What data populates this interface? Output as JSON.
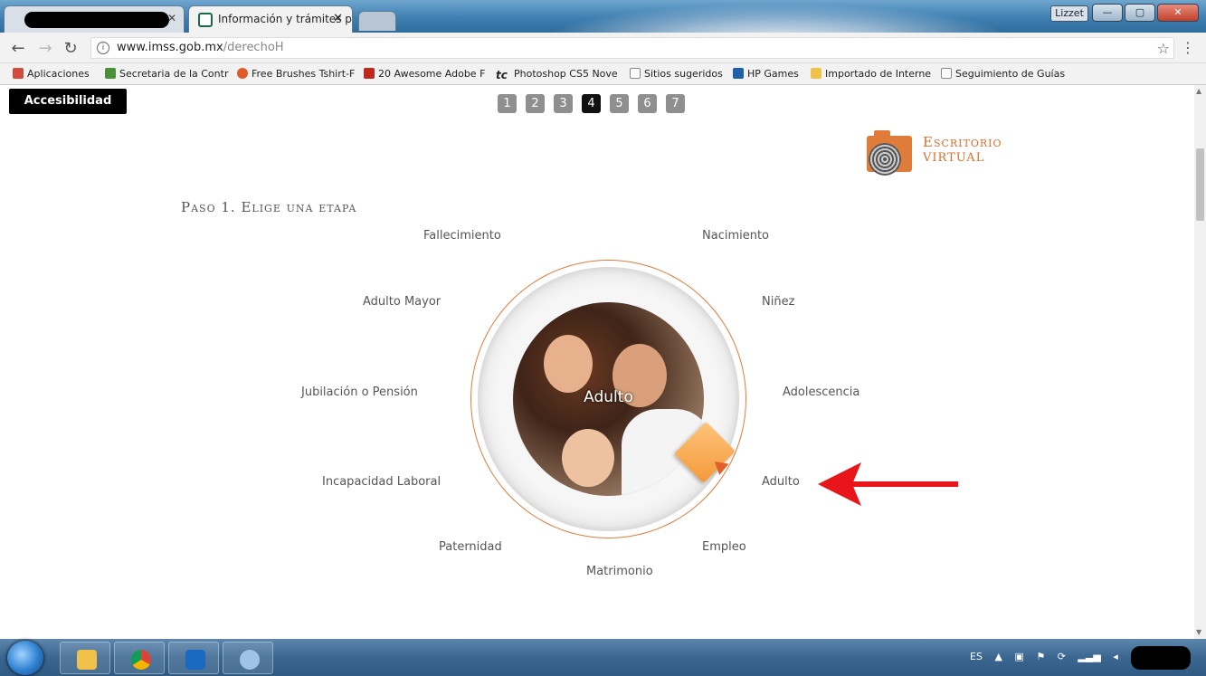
{
  "browser": {
    "tabs": [
      {
        "label": "",
        "redacted": true
      },
      {
        "label": "Información y trámites p",
        "active": true
      }
    ],
    "user_badge": "Lizzet",
    "url": {
      "host": "www.imss.gob.mx",
      "path": "/derechoH"
    },
    "bookmarks": [
      {
        "label": "Aplicaciones",
        "icon": "apps-grid-icon",
        "color": "#d04c3c"
      },
      {
        "label": "Secretaria de la Contr",
        "icon": "shield-icon",
        "color": "#4a8f3a"
      },
      {
        "label": "Free Brushes Tshirt-F",
        "icon": "brush-icon",
        "color": "#e05a2a"
      },
      {
        "label": "20 Awesome Adobe F",
        "icon": "tdm-icon",
        "color": "#c0281e"
      },
      {
        "label": "Photoshop CS5 Nove",
        "icon": "tc-icon",
        "color": "#222222"
      },
      {
        "label": "Sitios sugeridos",
        "icon": "page-icon",
        "color": "#888888"
      },
      {
        "label": "HP Games",
        "icon": "hp-games-icon",
        "color": "#1e5fa8"
      },
      {
        "label": "Importado de Interne",
        "icon": "folder-icon",
        "color": "#f0c24a"
      },
      {
        "label": "Seguimiento de Guías",
        "icon": "page-icon",
        "color": "#888888"
      }
    ]
  },
  "page": {
    "accessibility_label": "Accesibilidad",
    "pager": [
      "1",
      "2",
      "3",
      "4",
      "5",
      "6",
      "7"
    ],
    "pager_active": "4",
    "escritorio": {
      "line1": "Escritorio",
      "line2": "Virtual"
    },
    "step_title": "Paso 1. Elige una etapa",
    "center_label": "Adulto",
    "stages": {
      "fallecimiento": "Fallecimiento",
      "nacimiento": "Nacimiento",
      "adulto_mayor": "Adulto Mayor",
      "ninez": "Niñez",
      "jubilacion": "Jubilación o Pensión",
      "adolescencia": "Adolescencia",
      "incapacidad": "Incapacidad Laboral",
      "adulto": "Adulto",
      "paternidad": "Paternidad",
      "empleo": "Empleo",
      "matrimonio": "Matrimonio"
    }
  },
  "taskbar": {
    "apps": [
      "start-orb-icon",
      "file-explorer-icon",
      "chrome-icon",
      "outlook-icon",
      "paint-icon"
    ],
    "language": "ES"
  },
  "colors": {
    "accent": "#e07c3a",
    "arrow": "#e8151b"
  }
}
